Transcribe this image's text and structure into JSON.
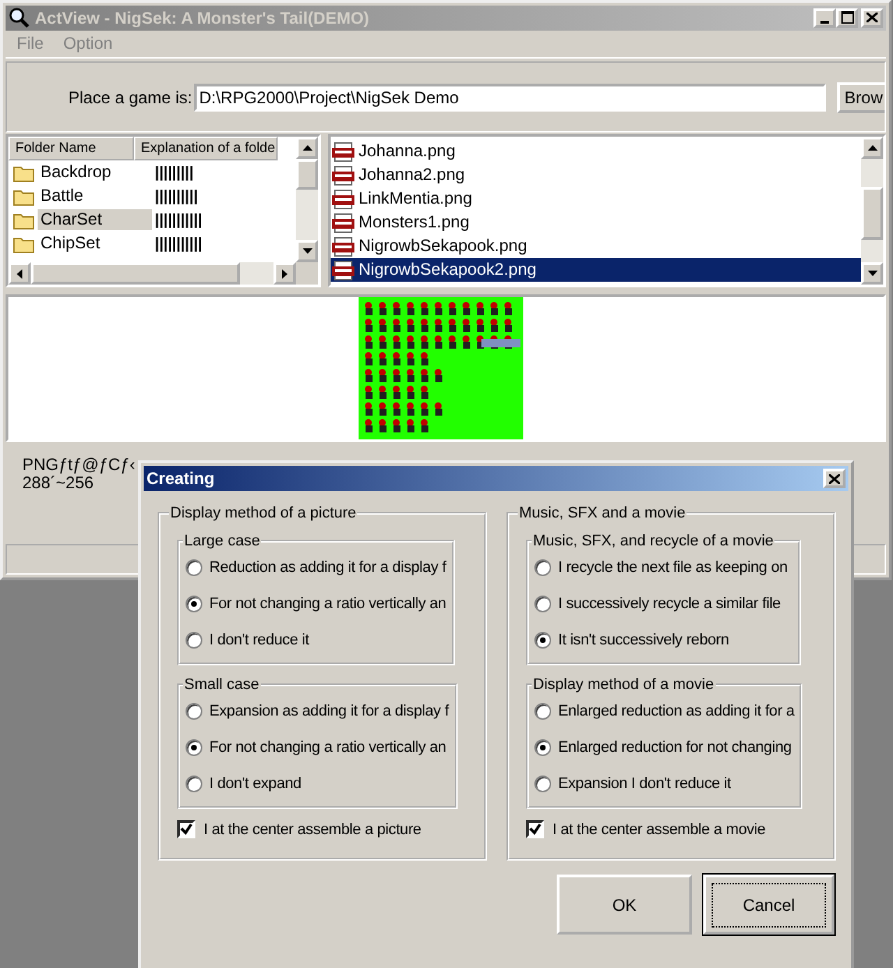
{
  "window": {
    "title": "ActView - NigSek: A Monster's Tail(DEMO)"
  },
  "menu": [
    "File",
    "Option"
  ],
  "path": {
    "label": "Place a game is:",
    "value": "D:\\RPG2000\\Project\\NigSek Demo",
    "button": "Brow"
  },
  "folders": {
    "columns": [
      "Folder Name",
      "Explanation of a folde"
    ],
    "rows": [
      {
        "name": "Backdrop",
        "explanation": "|||||||||",
        "selected": false
      },
      {
        "name": "Battle",
        "explanation": "||||||||||",
        "selected": false
      },
      {
        "name": "CharSet",
        "explanation": "|||||||||||",
        "selected": true
      },
      {
        "name": "ChipSet",
        "explanation": "|||||||||||",
        "selected": false
      }
    ]
  },
  "files": [
    {
      "name": "Johanna.png",
      "selected": false
    },
    {
      "name": "Johanna2.png",
      "selected": false
    },
    {
      "name": "LinkMentia.png",
      "selected": false
    },
    {
      "name": "Monsters1.png",
      "selected": false
    },
    {
      "name": "NigrowbSekapook.png",
      "selected": false
    },
    {
      "name": "NigrowbSekapook2.png",
      "selected": true
    }
  ],
  "preview": {
    "kind": "picture"
  },
  "info": [
    "PNGƒtƒ@ƒCƒ‹",
    "288´~256"
  ],
  "dialog": {
    "title": "Creating",
    "groups": [
      {
        "title": "Display method of a picture",
        "subgroups": [
          {
            "title": "Large case",
            "options": [
              {
                "label": "Reduction as adding it for a display f",
                "selected": false
              },
              {
                "label": "For not changing a ratio vertically an",
                "selected": true
              },
              {
                "label": "I don't reduce it",
                "selected": false
              }
            ]
          },
          {
            "title": "Small case",
            "options": [
              {
                "label": "Expansion as adding it for a display f",
                "selected": false
              },
              {
                "label": "For not changing a ratio vertically an",
                "selected": true
              },
              {
                "label": "I don't expand",
                "selected": false
              }
            ]
          }
        ],
        "checkbox": {
          "label": "I at the center assemble a picture",
          "checked": true
        }
      },
      {
        "title": "Music, SFX and a movie",
        "subgroups": [
          {
            "title": "Music, SFX, and recycle of a movie",
            "options": [
              {
                "label": "I recycle the next file as keeping on",
                "selected": false
              },
              {
                "label": "I successively recycle a similar file",
                "selected": false
              },
              {
                "label": "It isn't successively reborn",
                "selected": true
              }
            ]
          },
          {
            "title": "Display method of a movie",
            "options": [
              {
                "label": "Enlarged reduction as adding it for a",
                "selected": false
              },
              {
                "label": "Enlarged reduction for not changing",
                "selected": true
              },
              {
                "label": "Expansion I don't reduce it",
                "selected": false
              }
            ]
          }
        ],
        "checkbox": {
          "label": "I at the center assemble a movie",
          "checked": true
        }
      }
    ],
    "buttons": [
      {
        "label": "OK",
        "default": false
      },
      {
        "label": "Cancel",
        "default": true
      }
    ]
  }
}
